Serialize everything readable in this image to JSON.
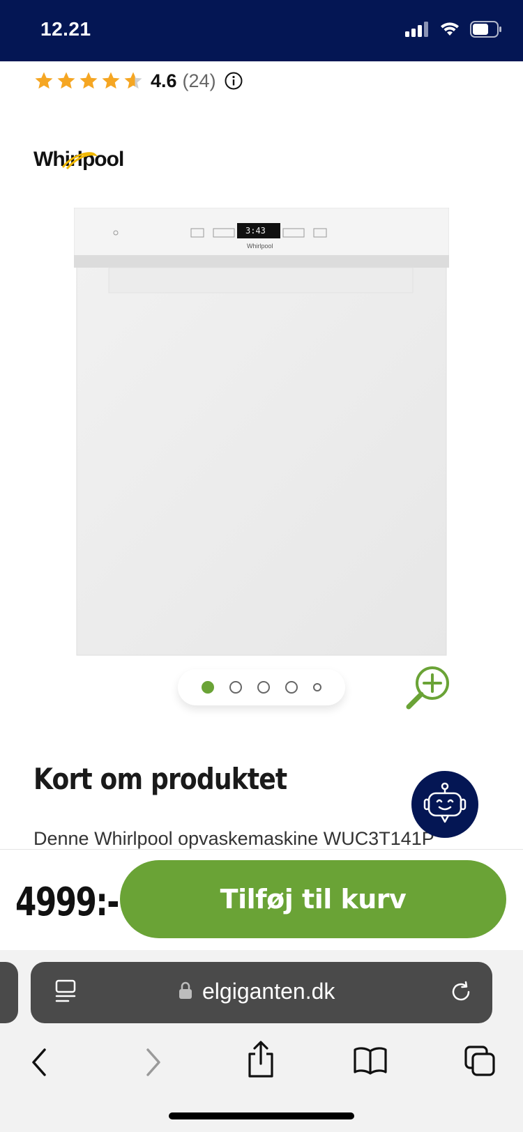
{
  "status": {
    "time": "12.21"
  },
  "rating": {
    "value": "4.6",
    "count": "(24)",
    "stars": 4.6
  },
  "brand": {
    "name": "Whirlpool"
  },
  "product": {
    "display_readout": "3:43",
    "panel_brand": "Whirlpool"
  },
  "carousel": {
    "total": 5,
    "active_index": 0
  },
  "section": {
    "title": "Kort om produktet",
    "description": "Denne Whirlpool opvaskemaskine WUC3T141P"
  },
  "buy": {
    "price": "4999:-",
    "add_label": "Tilføj til kurv"
  },
  "browser": {
    "url": "elgiganten.dk"
  },
  "colors": {
    "brand_navy": "#041654",
    "accent_green": "#6aa336",
    "star": "#f5a623"
  },
  "icons": [
    "signal-icon",
    "wifi-icon",
    "battery-icon",
    "star-icon",
    "info-icon",
    "zoom-in-icon",
    "chatbot-icon",
    "reader-icon",
    "lock-icon",
    "reload-icon",
    "back-icon",
    "forward-icon",
    "share-icon",
    "bookmarks-icon",
    "tabs-icon"
  ]
}
